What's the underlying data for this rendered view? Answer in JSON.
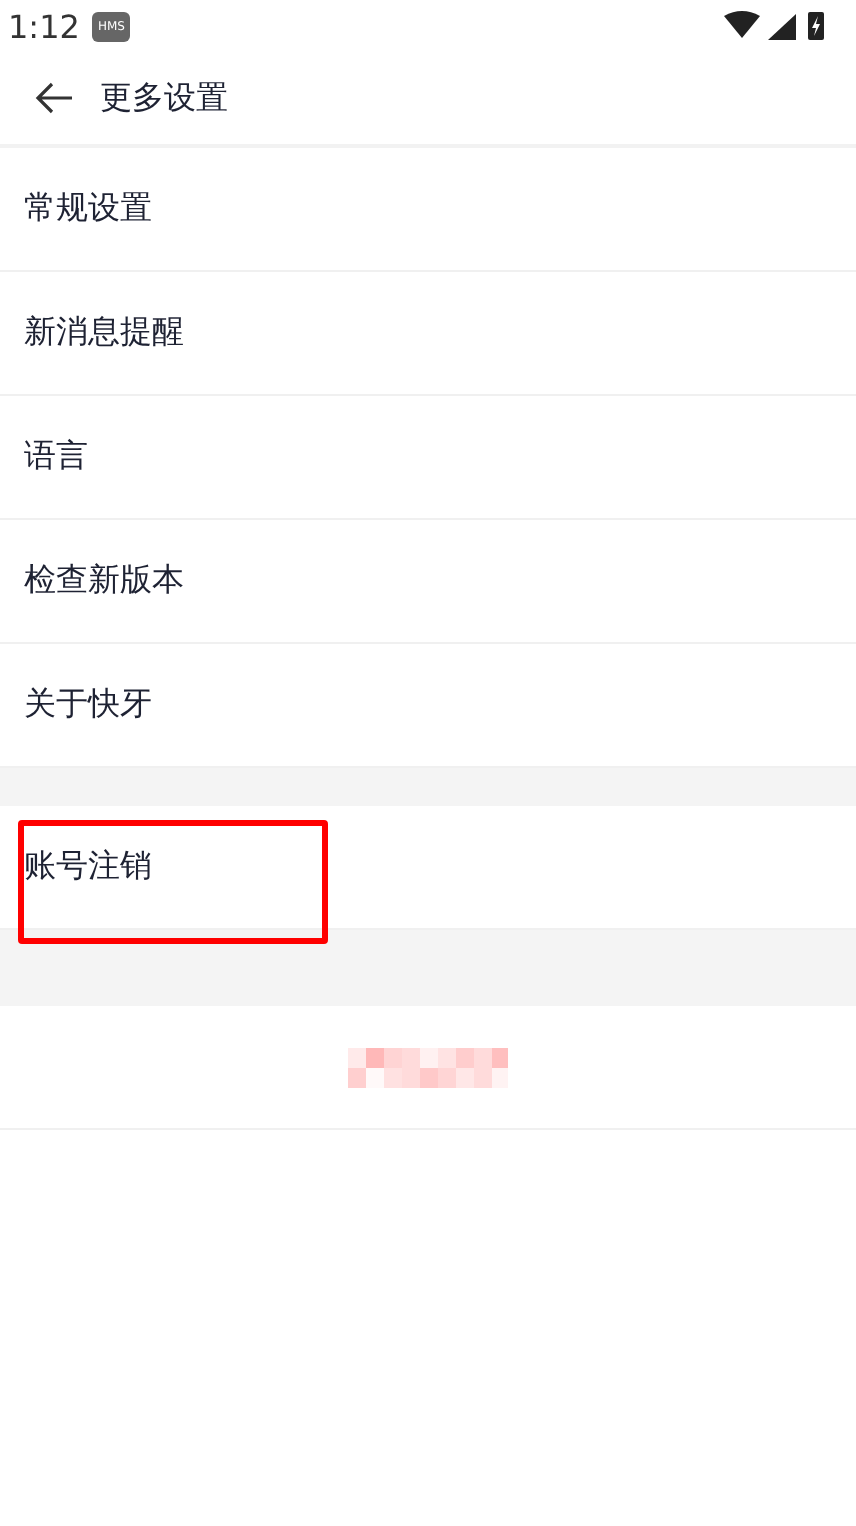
{
  "status_bar": {
    "time": "1:12",
    "badge": "HMS"
  },
  "header": {
    "title": "更多设置"
  },
  "groups": [
    {
      "items": [
        {
          "label": "常规设置"
        },
        {
          "label": "新消息提醒"
        },
        {
          "label": "语言"
        },
        {
          "label": "检查新版本"
        },
        {
          "label": "关于快牙"
        }
      ]
    },
    {
      "items": [
        {
          "label": "账号注销",
          "highlighted": true
        }
      ]
    }
  ],
  "footer_button": {
    "kind": "pixelated"
  }
}
